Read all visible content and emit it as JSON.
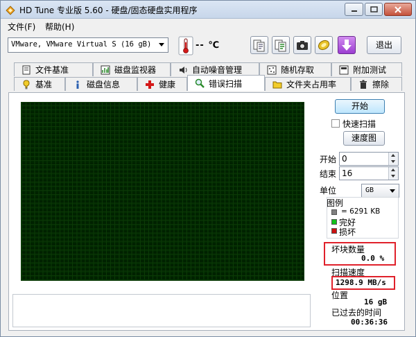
{
  "window": {
    "title": "HD Tune 专业版 5.60 - 硬盘/固态硬盘实用程序"
  },
  "menu": [
    {
      "label": "文件(F)"
    },
    {
      "label": "帮助(H)"
    }
  ],
  "toolbar": {
    "drive": "VMware, VMware Virtual S (16 gB)",
    "temperature": "-- ℃",
    "exit_label": "退出"
  },
  "tabs_row1": [
    {
      "label": "文件基准"
    },
    {
      "label": "磁盘监视器"
    },
    {
      "label": "自动噪音管理"
    },
    {
      "label": "随机存取"
    },
    {
      "label": "附加测试"
    }
  ],
  "tabs_row2": [
    {
      "label": "基准"
    },
    {
      "label": "磁盘信息"
    },
    {
      "label": "健康"
    },
    {
      "label": "错误扫描"
    },
    {
      "label": "文件夹占用率"
    },
    {
      "label": "擦除"
    }
  ],
  "scan": {
    "start_button": "开始",
    "quick_scan": "快速扫描",
    "quick_scan_checked": false,
    "speed_map": "速度图",
    "start_label": "开始",
    "start_value": "0",
    "end_label": "结束",
    "end_value": "16",
    "unit_label": "单位",
    "unit_value": "GB",
    "legend_title": "图例",
    "legend_block": "= 6291 KB",
    "legend_ok": "完好",
    "legend_damaged": "损坏",
    "bad_blocks_label": "坏块数量",
    "bad_blocks_value": "0.0 %",
    "speed_label": "扫描速度",
    "speed_value": "1298.9 MB/s",
    "position_label": "位置",
    "position_value": "16 gB",
    "elapsed_label": "已过去的时间",
    "elapsed_value": "00:36:36"
  },
  "colors": {
    "ok": "#10c21a",
    "damaged": "#cc1111",
    "block": "#7f7f7f",
    "highlight": "#e0202a"
  }
}
